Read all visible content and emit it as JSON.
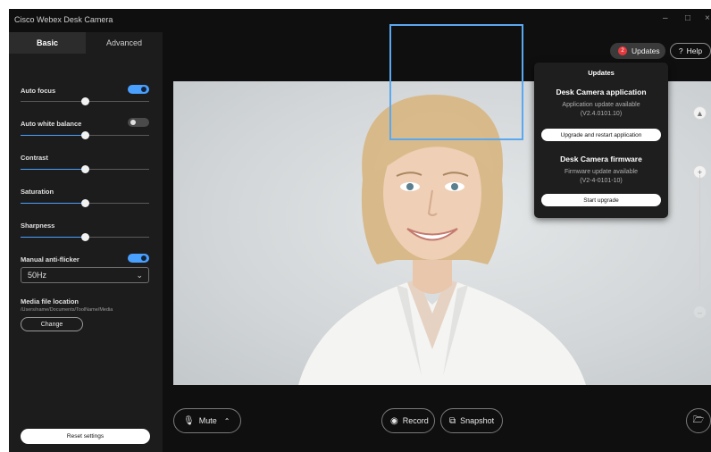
{
  "app": {
    "title": "Cisco Webex Desk Camera",
    "minimize": "–",
    "maximize": "□",
    "close": "×"
  },
  "sidebar": {
    "tabs": [
      {
        "label": "Basic"
      },
      {
        "label": "Advanced"
      }
    ],
    "auto_focus": {
      "label": "Auto focus",
      "enabled": true,
      "slider_value": 0.5
    },
    "auto_white_balance": {
      "label": "Auto white balance",
      "enabled": false,
      "slider_value": 0.5
    },
    "contrast": {
      "label": "Contrast",
      "slider_value": 0.5
    },
    "saturation": {
      "label": "Saturation",
      "slider_value": 0.5
    },
    "sharpness": {
      "label": "Sharpness",
      "slider_value": 0.5
    },
    "manual_anti_flicker": {
      "label": "Manual anti-flicker",
      "enabled": true,
      "selected": "50Hz"
    },
    "media": {
      "label": "Media file location",
      "path": "/Users/name/Documents/ToolName/Media",
      "change_label": "Change"
    },
    "reset_label": "Reset settings"
  },
  "header": {
    "updates_label": "Updates",
    "updates_count": "2",
    "help_label": "Help",
    "help_icon": "?"
  },
  "updates_popup": {
    "title": "Updates",
    "app_section": {
      "heading": "Desk Camera application",
      "line1": "Application update available",
      "line2": "(V2.4.0101.10)",
      "button": "Upgrade and restart application"
    },
    "firmware_section": {
      "heading": "Desk Camera firmware",
      "line1": "Firmware update available",
      "line2": "(V2-4-0101-10)",
      "button": "Start upgrade"
    }
  },
  "zoom": {
    "plus": "+",
    "minus": "–"
  },
  "bottom_bar": {
    "mute_label": "Mute",
    "record_label": "Record",
    "snapshot_label": "Snapshot"
  },
  "colors": {
    "accent": "#4aa0ff",
    "badge": "#e5393f",
    "highlight": "#5aa8f0"
  }
}
